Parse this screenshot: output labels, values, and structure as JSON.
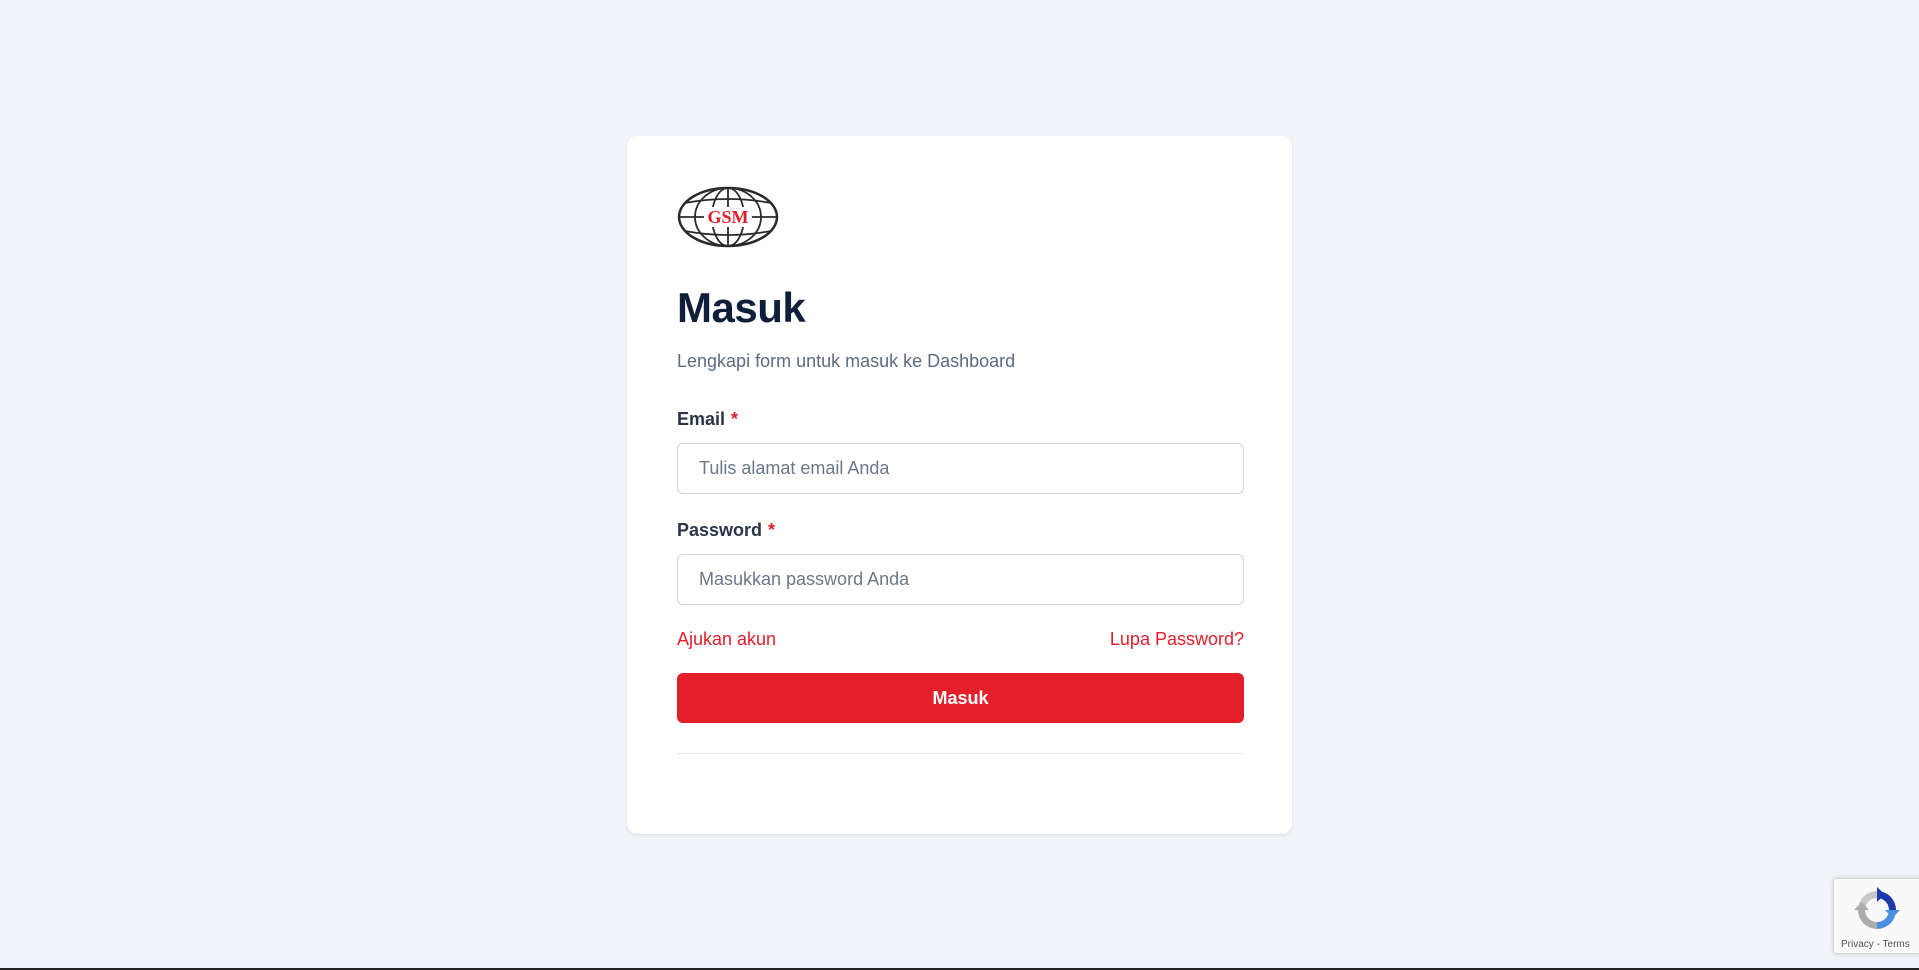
{
  "logo": {
    "text": "GSM",
    "icon": "globe-logo",
    "color": "#e31e2a"
  },
  "login": {
    "title": "Masuk",
    "subtitle": "Lengkapi form untuk masuk ke Dashboard",
    "email": {
      "label": "Email",
      "required_mark": "*",
      "placeholder": "Tulis alamat email Anda",
      "value": ""
    },
    "password": {
      "label": "Password",
      "required_mark": "*",
      "placeholder": "Masukkan password Anda",
      "value": ""
    },
    "register_link": "Ajukan akun",
    "forgot_link": "Lupa Password?",
    "submit_label": "Masuk"
  },
  "recaptcha": {
    "icon": "recaptcha-icon",
    "privacy": "Privacy",
    "separator": "-",
    "terms": "Terms"
  },
  "colors": {
    "accent": "#e41f2a",
    "background": "#f0f4f8",
    "title": "#0f1e3a",
    "muted": "#5b6b82"
  }
}
